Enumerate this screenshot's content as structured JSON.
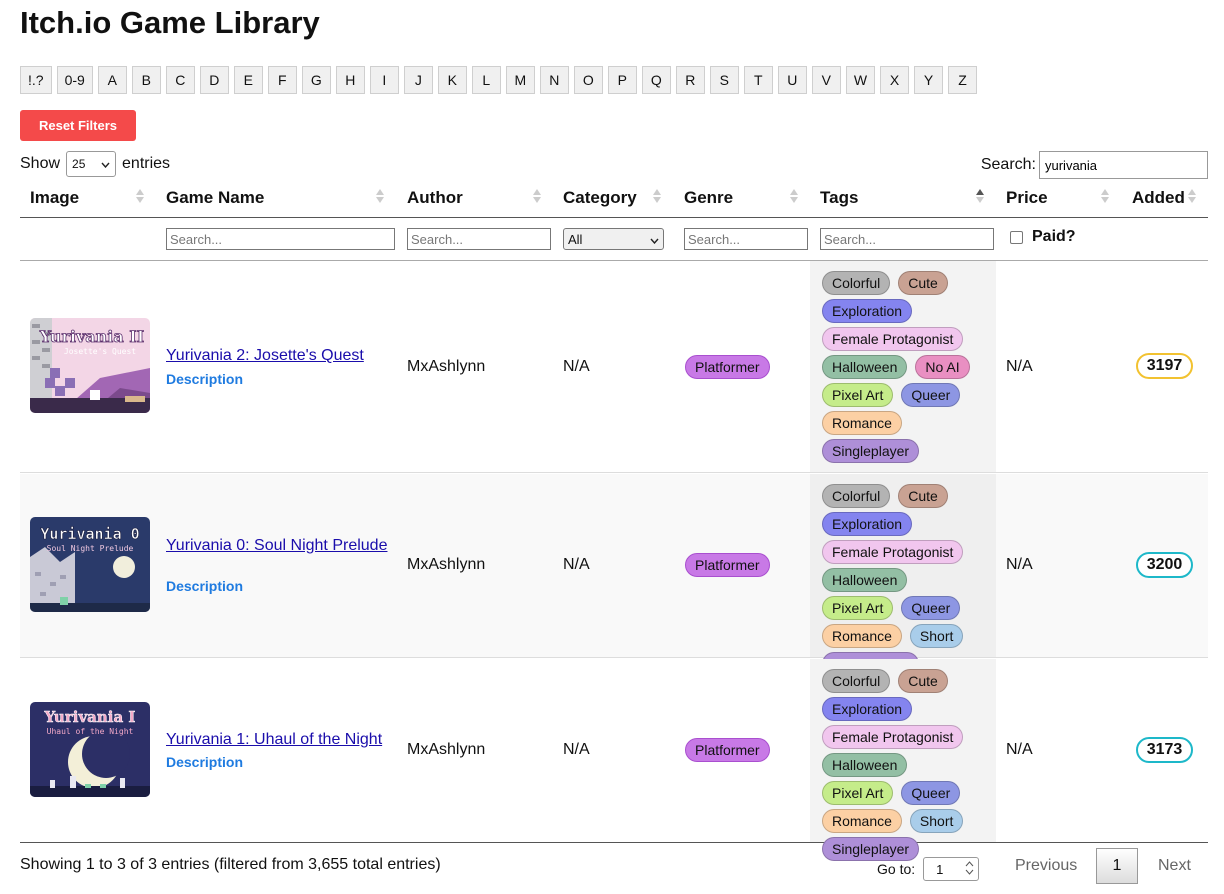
{
  "title": "Itch.io Game Library",
  "letters": [
    "!.?",
    "0-9",
    "A",
    "B",
    "C",
    "D",
    "E",
    "F",
    "G",
    "H",
    "I",
    "J",
    "K",
    "L",
    "M",
    "N",
    "O",
    "P",
    "Q",
    "R",
    "S",
    "T",
    "U",
    "V",
    "W",
    "X",
    "Y",
    "Z"
  ],
  "reset_label": "Reset Filters",
  "show": {
    "prefix": "Show",
    "value": "25",
    "suffix": "entries"
  },
  "search": {
    "label": "Search:",
    "value": "yurivania"
  },
  "columns": [
    "Image",
    "Game Name",
    "Author",
    "Category",
    "Genre",
    "Tags",
    "Price",
    "Added"
  ],
  "filters": {
    "placeholder": "Search...",
    "category_value": "All",
    "paid_label": "Paid?"
  },
  "rows": [
    {
      "name": "Yurivania 2: Josette's Quest",
      "description": "Description",
      "author": "MxAshlynn",
      "category": "N/A",
      "genre": "Platformer",
      "tags": [
        "Colorful",
        "Cute",
        "Exploration",
        "Female Protagonist",
        "Halloween",
        "No AI",
        "Pixel Art",
        "Queer",
        "Romance",
        "Singleplayer"
      ],
      "price": "N/A",
      "added": "3197",
      "added_color": "#f2c230",
      "thumb_title": "Yurivania II",
      "thumb_subtitle": "Josette's Quest"
    },
    {
      "name": "Yurivania 0: Soul Night Prelude",
      "description": "Description",
      "author": "MxAshlynn",
      "category": "N/A",
      "genre": "Platformer",
      "tags": [
        "Colorful",
        "Cute",
        "Exploration",
        "Female Protagonist",
        "Halloween",
        "Pixel Art",
        "Queer",
        "Romance",
        "Short",
        "Singleplayer"
      ],
      "price": "N/A",
      "added": "3200",
      "added_color": "#1db8c9",
      "thumb_title": "Yurivania 0",
      "thumb_subtitle": "Soul Night Prelude"
    },
    {
      "name": "Yurivania 1: Uhaul of the Night",
      "description": "Description",
      "author": "MxAshlynn",
      "category": "N/A",
      "genre": "Platformer",
      "tags": [
        "Colorful",
        "Cute",
        "Exploration",
        "Female Protagonist",
        "Halloween",
        "Pixel Art",
        "Queer",
        "Romance",
        "Short",
        "Singleplayer"
      ],
      "price": "N/A",
      "added": "3173",
      "added_color": "#1db8c9",
      "thumb_title": "Yurivania I",
      "thumb_subtitle": "Uhaul of the Night"
    }
  ],
  "tag_colors": {
    "Colorful": "#b3b3b3",
    "Cute": "#c9a293",
    "Exploration": "#8484ef",
    "Female Protagonist": "#f1c6ee",
    "Halloween": "#93bfa4",
    "No AI": "#e98fc2",
    "Pixel Art": "#c5ec8a",
    "Queer": "#8d96e3",
    "Romance": "#fcd0a4",
    "Short": "#a9cdea",
    "Singleplayer": "#ae8fd8"
  },
  "footer": {
    "info": "Showing 1 to 3 of 3 entries (filtered from 3,655 total entries)",
    "goto_label": "Go to:",
    "goto_value": "1",
    "previous": "Previous",
    "current_page": "1",
    "next": "Next"
  }
}
